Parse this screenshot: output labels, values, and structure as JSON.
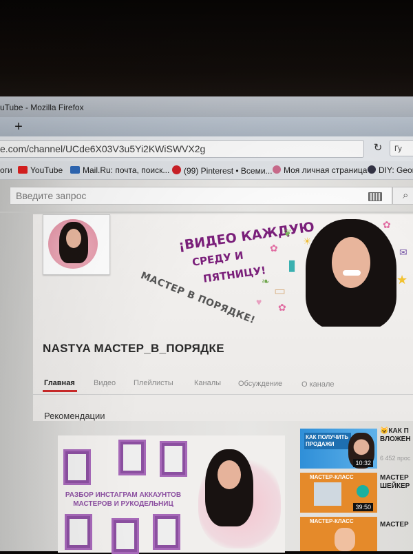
{
  "window": {
    "title": "uTube - Mozilla Firefox"
  },
  "tabstrip": {
    "new_tab_icon": "+"
  },
  "navbar": {
    "url": "e.com/channel/UCde6X03V3u5Yi2KWiSWVX2g",
    "search_placeholder": "Гу"
  },
  "bookmarks": [
    {
      "label": "оги",
      "icon": "none"
    },
    {
      "label": "YouTube",
      "icon": "youtube-icon",
      "color": "#e02020"
    },
    {
      "label": "Mail.Ru: почта, поиск...",
      "icon": "mailru-icon",
      "color": "#2e68b6"
    },
    {
      "label": "(99) Pinterest • Всеми...",
      "icon": "pinterest-icon",
      "color": "#cb2027"
    },
    {
      "label": "Моя личная страница",
      "icon": "ok-icon",
      "color": "#c86a8a"
    },
    {
      "label": "DIY: Geom",
      "icon": "globe-icon",
      "color": "#334"
    }
  ],
  "youtube": {
    "search_placeholder": "Введите запрос",
    "channel_art": {
      "slogan_line1": "¡ВИДЕО КАЖДУЮ",
      "slogan_line2": "СРЕДУ И",
      "slogan_line3": "ПЯТНИЦУ!",
      "slogan_sub": "МАСТЕР В ПОРЯДКЕ!"
    },
    "channel_name": "NASTYA МАСТЕР_В_ПОРЯДКЕ",
    "tabs": [
      "Главная",
      "Видео",
      "Плейлисты",
      "Каналы",
      "Обсуждение",
      "О канале"
    ],
    "active_tab": "Главная",
    "section_title": "Рекомендации",
    "featured": {
      "caption": "РАЗБОР ИНСТАГРАМ АККАУНТОВ МАСТЕРОВ И РУКОДЕЛЬНИЦ"
    },
    "sidebar_videos": [
      {
        "thumb_text": "КАК ПОЛУЧИТЬ ПРОДАЖИ",
        "duration": "10:32",
        "title_line1": "😺КАК П",
        "title_line2": "ВЛОЖЕН",
        "meta": "6 452 прос"
      },
      {
        "thumb_text": "МАСТЕР-КЛАСС",
        "duration": "39:50",
        "title_line1": "МАСТЕР",
        "title_line2": "ШЕЙКЕР",
        "meta": ""
      },
      {
        "thumb_text": "МАСТЕР-КЛАСС",
        "duration": "",
        "title_line1": "МАСТЕР",
        "title_line2": "",
        "meta": ""
      }
    ]
  },
  "colors": {
    "accent_red": "#cc2a2a",
    "brand_purple": "#8b4fa0"
  }
}
